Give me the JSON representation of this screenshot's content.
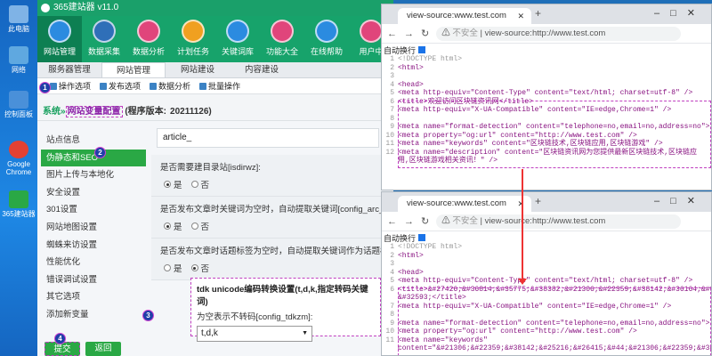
{
  "desktop": {
    "icons": [
      {
        "label": "此电脑",
        "icon": "computer-icon",
        "color": "#7fb3e6"
      },
      {
        "label": "网络",
        "icon": "network-icon",
        "color": "#5fa8e0"
      },
      {
        "label": "控制面板",
        "icon": "control-panel-icon",
        "color": "#4a90d9"
      },
      {
        "label": "Google Chrome",
        "icon": "chrome-icon",
        "color": "#e34133"
      },
      {
        "label": "365建站器",
        "icon": "app-icon",
        "color": "#2aa845"
      }
    ]
  },
  "app": {
    "title": "365建站器 v11.0",
    "toolbar": [
      {
        "label": "网站管理",
        "icon": "website-icon",
        "color": "#2b8be0"
      },
      {
        "label": "数据采集",
        "icon": "collect-icon",
        "color": "#2f6fb8"
      },
      {
        "label": "数据分析",
        "icon": "analysis-icon",
        "color": "#e0457b"
      },
      {
        "label": "计划任务",
        "icon": "schedule-icon",
        "color": "#f0a020"
      },
      {
        "label": "关键词库",
        "icon": "keyword-icon",
        "color": "#2b8be0"
      },
      {
        "label": "功能大全",
        "icon": "tools-icon",
        "color": "#e0457b"
      },
      {
        "label": "在线帮助",
        "icon": "help-icon",
        "color": "#2b8be0"
      },
      {
        "label": "用户中",
        "icon": "user-icon",
        "color": "#e0457b"
      }
    ],
    "main_tabs": [
      "服务器管理",
      "网站管理",
      "网站建设",
      "内容建设"
    ],
    "sub_tabs": [
      "操作选项",
      "发布选项",
      "数据分析",
      "批量操作"
    ],
    "sys_text": {
      "prefix": "系统»",
      "highlight": "网站变量配置",
      "version_label": "(程序版本:",
      "version": "20211126",
      "suffix": ")"
    },
    "sidebar": [
      "站点信息",
      "伪静态和SEO",
      "图片上传与本地化",
      "安全设置",
      "301设置",
      "网站地图设置",
      "蜘蛛来访设置",
      "性能优化",
      "错误调试设置",
      "其它选项",
      "添加新变量"
    ],
    "field_value": "article_",
    "q1": {
      "label": "是否需要建目录站[isdirwz]:",
      "yes": "是",
      "no": "否"
    },
    "q2": {
      "label": "是否发布文章时关键词为空时，自动提取关键词[config_arc_au",
      "yes": "是",
      "no": "否"
    },
    "q3": {
      "label": "是否发布文章时话题标签为空时，自动提取关键词作为话题标签[c",
      "yes": "是",
      "no": "否"
    },
    "tdk": {
      "title": "tdk unicode编码转换设置(t,d,k,指定转码关键词)",
      "subtitle": "为空表示不转码[config_tdkzm]:",
      "value": "t,d,k"
    },
    "buttons": {
      "submit": "提交",
      "back": "返回"
    },
    "badges": [
      "1",
      "2",
      "3",
      "4"
    ]
  },
  "browser_top": {
    "tab_title": "view-source:www.test.com",
    "insecure": "不安全",
    "url": "view-source:http://www.test.com",
    "auto_wrap": "自动换行",
    "lines": [
      {
        "n": "1",
        "t": "<!DOCTYPE html>"
      },
      {
        "n": "2",
        "t": "<html>"
      },
      {
        "n": "3",
        "t": ""
      },
      {
        "n": "4",
        "t": "<head>"
      },
      {
        "n": "5",
        "t": "<meta http-equiv=\"Content-Type\" content=\"text/html; charset=utf-8\" />"
      },
      {
        "n": "6",
        "t": "<title>欢迎访问区块链资讯网</title>"
      },
      {
        "n": "7",
        "t": "<meta http-equiv=\"X-UA-Compatible\" content=\"IE=edge,Chrome=1\" />"
      },
      {
        "n": "8",
        "t": ""
      },
      {
        "n": "9",
        "t": "<meta name=\"format-detection\" content=\"telephone=no,email=no,address=no\">"
      },
      {
        "n": "10",
        "t": "<meta property=\"og:url\" content=\"http://www.test.com\" />"
      },
      {
        "n": "11",
        "t": "<meta name=\"keywords\" content=\"区块链技术,区块链应用,区块链游戏\" />"
      },
      {
        "n": "12",
        "t": "<meta name=\"description\" content=\"区块链资讯网为您提供最新区块链技术,区块链应"
      },
      {
        "n": "",
        "t": "用,区块链游戏相关资讯！\" />"
      }
    ]
  },
  "browser_bottom": {
    "tab_title": "view-source:www.test.com",
    "insecure": "不安全",
    "url": "view-source:http://www.test.com",
    "auto_wrap": "自动换行",
    "lines": [
      {
        "n": "1",
        "t": "<!DOCTYPE html>"
      },
      {
        "n": "2",
        "t": "<html>"
      },
      {
        "n": "3",
        "t": ""
      },
      {
        "n": "4",
        "t": "<head>"
      },
      {
        "n": "5",
        "t": "<meta http-equiv=\"Content-Type\" content=\"text/html; charset=utf-8\" />"
      },
      {
        "n": "6",
        "t": "<title>&#27426;&#36814;&#35775;&#38382;&#21306;&#22359;&#38142;&#36164;&#3576"
      },
      {
        "n": "",
        "t": "&#32593;</title>"
      },
      {
        "n": "7",
        "t": "<meta http-equiv=\"X-UA-Compatible\" content=\"IE=edge,Chrome=1\" />"
      },
      {
        "n": "8",
        "t": ""
      },
      {
        "n": "9",
        "t": "<meta name=\"format-detection\" content=\"telephone=no,email=no,address=no\">"
      },
      {
        "n": "10",
        "t": "<meta property=\"og:url\" content=\"http://www.test.com\" />"
      },
      {
        "n": "11",
        "t": "<meta name=\"keywords\""
      },
      {
        "n": "",
        "t": "content=\"&#21306;&#22359;&#38142;&#25216;&#26415;&#44;&#21306;&#22359;&#38142;"
      }
    ]
  }
}
